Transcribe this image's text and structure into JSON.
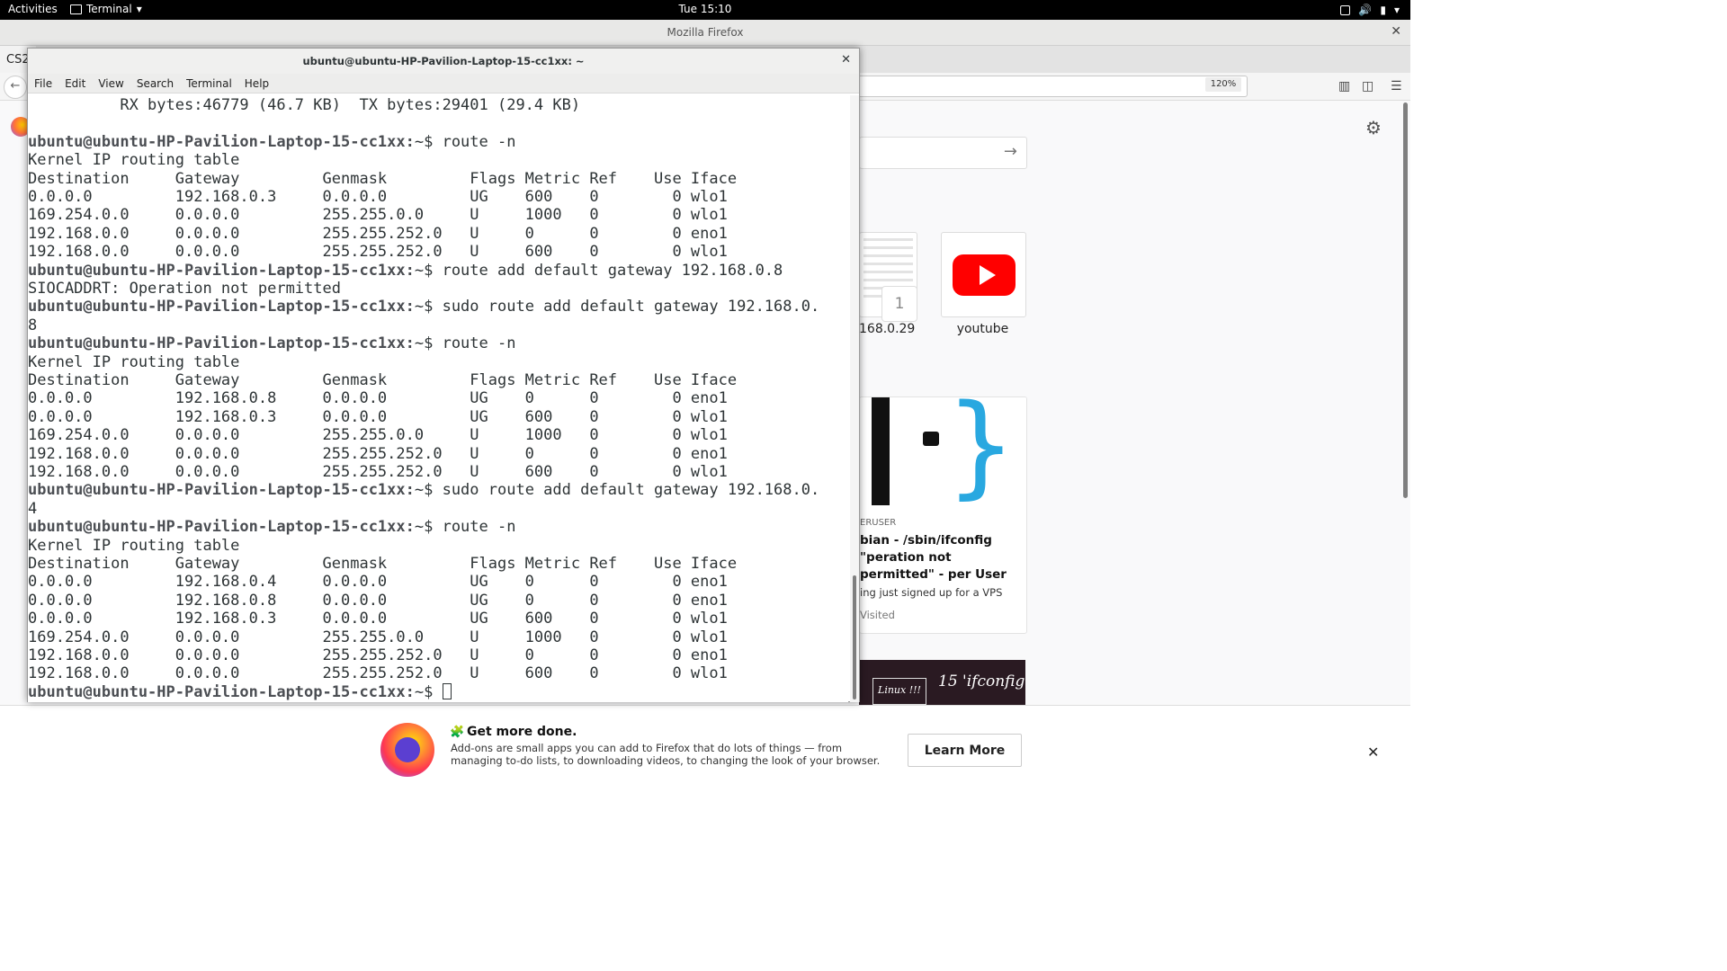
{
  "topbar": {
    "activities": "Activities",
    "app_menu": "Terminal",
    "clock": "Tue 15:10"
  },
  "firefox": {
    "window_title": "Mozilla Firefox",
    "tab_label": "CS2",
    "zoom": "120%",
    "tile1_number": "1",
    "tile1_label": "168.0.29",
    "tile2_label": "youtube",
    "highlight": {
      "source": "ERUSER",
      "title": "bian - /sbin/ifconfig \"peration not permitted\" - per User",
      "desc": "ing just signed up for a VPS",
      "visited": "Visited"
    },
    "highlight2": {
      "badge": "Linux !!!",
      "text": "15 'ifconfig"
    },
    "notification": {
      "heading": "Get more done.",
      "body": "Add-ons are small apps you can add to Firefox that do lots of things — from managing to-do lists, to downloading videos, to changing the look of your browser.",
      "button": "Learn More"
    }
  },
  "terminal": {
    "title": "ubuntu@ubuntu-HP-Pavilion-Laptop-15-cc1xx: ~",
    "menu": [
      "File",
      "Edit",
      "View",
      "Search",
      "Terminal",
      "Help"
    ],
    "prompt": "ubuntu@ubuntu-HP-Pavilion-Laptop-15-cc1xx:",
    "lines": [
      {
        "t": "text",
        "text": "          RX bytes:46779 (46.7 KB)  TX bytes:29401 (29.4 KB)"
      },
      {
        "t": "text",
        "text": ""
      },
      {
        "t": "cmd",
        "cmd": "~$ route -n"
      },
      {
        "t": "text",
        "text": "Kernel IP routing table"
      },
      {
        "t": "text",
        "text": "Destination     Gateway         Genmask         Flags Metric Ref    Use Iface"
      },
      {
        "t": "text",
        "text": "0.0.0.0         192.168.0.3     0.0.0.0         UG    600    0        0 wlo1"
      },
      {
        "t": "text",
        "text": "169.254.0.0     0.0.0.0         255.255.0.0     U     1000   0        0 wlo1"
      },
      {
        "t": "text",
        "text": "192.168.0.0     0.0.0.0         255.255.252.0   U     0      0        0 eno1"
      },
      {
        "t": "text",
        "text": "192.168.0.0     0.0.0.0         255.255.252.0   U     600    0        0 wlo1"
      },
      {
        "t": "cmd",
        "cmd": "~$ route add default gateway 192.168.0.8"
      },
      {
        "t": "text",
        "text": "SIOCADDRT: Operation not permitted"
      },
      {
        "t": "cmd",
        "cmd": "~$ sudo route add default gateway 192.168.0."
      },
      {
        "t": "text",
        "text": "8"
      },
      {
        "t": "cmd",
        "cmd": "~$ route -n"
      },
      {
        "t": "text",
        "text": "Kernel IP routing table"
      },
      {
        "t": "text",
        "text": "Destination     Gateway         Genmask         Flags Metric Ref    Use Iface"
      },
      {
        "t": "text",
        "text": "0.0.0.0         192.168.0.8     0.0.0.0         UG    0      0        0 eno1"
      },
      {
        "t": "text",
        "text": "0.0.0.0         192.168.0.3     0.0.0.0         UG    600    0        0 wlo1"
      },
      {
        "t": "text",
        "text": "169.254.0.0     0.0.0.0         255.255.0.0     U     1000   0        0 wlo1"
      },
      {
        "t": "text",
        "text": "192.168.0.0     0.0.0.0         255.255.252.0   U     0      0        0 eno1"
      },
      {
        "t": "text",
        "text": "192.168.0.0     0.0.0.0         255.255.252.0   U     600    0        0 wlo1"
      },
      {
        "t": "cmd",
        "cmd": "~$ sudo route add default gateway 192.168.0."
      },
      {
        "t": "text",
        "text": "4"
      },
      {
        "t": "cmd",
        "cmd": "~$ route -n"
      },
      {
        "t": "text",
        "text": "Kernel IP routing table"
      },
      {
        "t": "text",
        "text": "Destination     Gateway         Genmask         Flags Metric Ref    Use Iface"
      },
      {
        "t": "text",
        "text": "0.0.0.0         192.168.0.4     0.0.0.0         UG    0      0        0 eno1"
      },
      {
        "t": "text",
        "text": "0.0.0.0         192.168.0.8     0.0.0.0         UG    0      0        0 eno1"
      },
      {
        "t": "text",
        "text": "0.0.0.0         192.168.0.3     0.0.0.0         UG    600    0        0 wlo1"
      },
      {
        "t": "text",
        "text": "169.254.0.0     0.0.0.0         255.255.0.0     U     1000   0        0 wlo1"
      },
      {
        "t": "text",
        "text": "192.168.0.0     0.0.0.0         255.255.252.0   U     0      0        0 eno1"
      },
      {
        "t": "text",
        "text": "192.168.0.0     0.0.0.0         255.255.252.0   U     600    0        0 wlo1"
      },
      {
        "t": "cmd",
        "cmd": "~$ ",
        "cursor": true
      }
    ]
  }
}
